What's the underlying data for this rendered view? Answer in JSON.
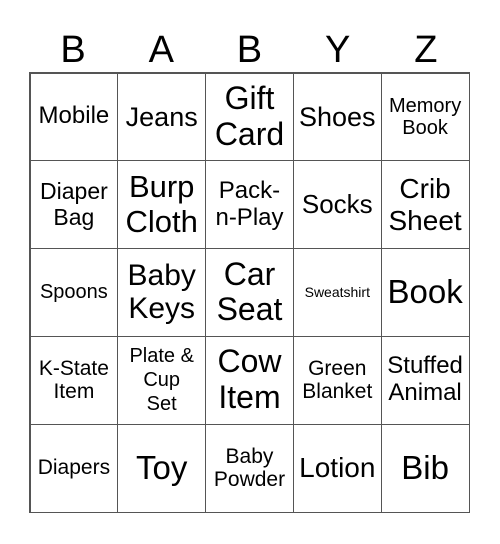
{
  "header": [
    "B",
    "A",
    "B",
    "Y",
    "Z"
  ],
  "cells": [
    "Mobile",
    "Jeans",
    "Gift\nCard",
    "Shoes",
    "Memory\nBook",
    "Diaper\nBag",
    "Burp\nCloth",
    "Pack-\nn-Play",
    "Socks",
    "Crib\nSheet",
    "Spoons",
    "Baby\nKeys",
    "Car\nSeat",
    "Sweatshirt",
    "Book",
    "K-State\nItem",
    "Plate &\nCup\nSet",
    "Cow\nItem",
    "Green\nBlanket",
    "Stuffed\nAnimal",
    "Diapers",
    "Toy",
    "Baby\nPowder",
    "Lotion",
    "Bib"
  ]
}
